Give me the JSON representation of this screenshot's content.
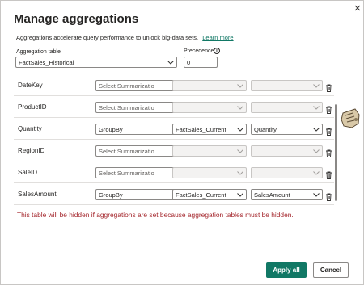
{
  "dialog": {
    "title": "Manage aggregations",
    "description": "Aggregations accelerate query performance to unlock big-data sets.",
    "learn_more": "Learn more",
    "close_icon": "close-icon"
  },
  "aggregation_table": {
    "label": "Aggregation table",
    "value": "FactSales_Historical"
  },
  "precedence": {
    "label": "Precedence",
    "value": "0",
    "info_icon": "info-icon"
  },
  "rows": [
    {
      "column": "DateKey",
      "summarization": "Select Summarizatio",
      "summ_placeholder": true,
      "detail_table": "",
      "detail_column": "",
      "enabled": false
    },
    {
      "column": "ProductID",
      "summarization": "Select Summarizatio",
      "summ_placeholder": true,
      "detail_table": "",
      "detail_column": "",
      "enabled": false
    },
    {
      "column": "Quantity",
      "summarization": "GroupBy",
      "summ_placeholder": false,
      "detail_table": "FactSales_Current",
      "detail_column": "Quantity",
      "enabled": true
    },
    {
      "column": "RegionID",
      "summarization": "Select Summarizatio",
      "summ_placeholder": true,
      "detail_table": "",
      "detail_column": "",
      "enabled": false
    },
    {
      "column": "SaleID",
      "summarization": "Select Summarizatio",
      "summ_placeholder": true,
      "detail_table": "",
      "detail_column": "",
      "enabled": false
    },
    {
      "column": "SalesAmount",
      "summarization": "GroupBy",
      "summ_placeholder": false,
      "detail_table": "FactSales_Current",
      "detail_column": "SalesAmount",
      "enabled": true
    }
  ],
  "warning": "This table will be hidden if aggregations are set because aggregation tables must be hidden.",
  "buttons": {
    "apply": "Apply all",
    "cancel": "Cancel"
  },
  "colors": {
    "accent": "#117865",
    "warning": "#a4262c"
  }
}
